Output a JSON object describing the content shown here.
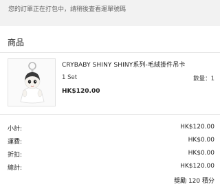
{
  "notice": "您的訂單正在打包中，請稍後查看運單號碼",
  "section_title": "商品",
  "product": {
    "name": "CRYBABY SHINY SHINY系列-毛絨掛件吊卡",
    "variant": "1 Set",
    "quantity": "數量：1",
    "price": "HK$120.00",
    "image_icon": "crybaby-plush-keychain-image"
  },
  "summary": [
    {
      "label": "小計:",
      "value": "HK$120.00"
    },
    {
      "label": "運費:",
      "value": "HK$0.00"
    },
    {
      "label": "折扣:",
      "value": "HK$0.00"
    },
    {
      "label": "總計:",
      "value": "HK$120.00"
    }
  ],
  "reward": "獎勵 120 積分"
}
